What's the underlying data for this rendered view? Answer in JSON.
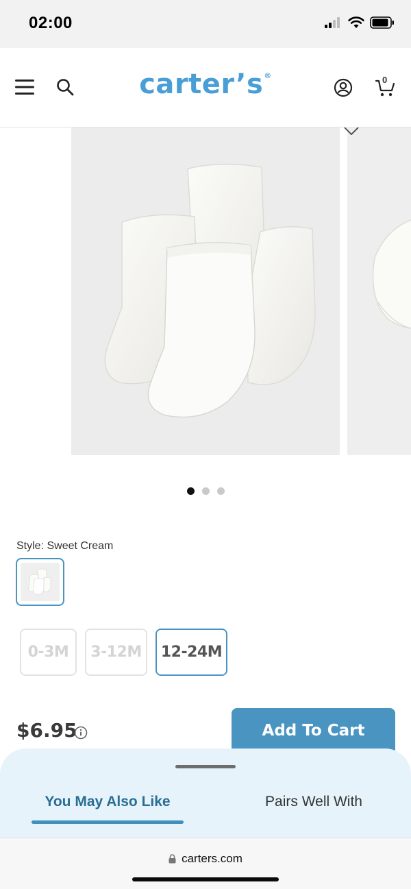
{
  "status_bar": {
    "time": "02:00"
  },
  "header": {
    "logo_text": "carter’s",
    "logo_mark": "®",
    "cart_count": "0",
    "icons": [
      "menu-icon",
      "search-icon",
      "account-icon",
      "cart-icon"
    ]
  },
  "gallery": {
    "total_slides": 3,
    "active_slide": 1,
    "image_description": "white baby socks"
  },
  "product": {
    "style_label": "Style: Sweet Cream",
    "sizes": [
      {
        "label": "0-3M",
        "state": "unavailable"
      },
      {
        "label": "3-12M",
        "state": "unavailable"
      },
      {
        "label": "12-24M",
        "state": "selected"
      }
    ],
    "price": "$6.95",
    "add_to_cart": "Add To Cart"
  },
  "bottom_sheet": {
    "tabs": [
      {
        "label": "You May Also Like",
        "active": true
      },
      {
        "label": "Pairs Well With",
        "active": false
      }
    ]
  },
  "browser": {
    "url": "carters.com"
  },
  "colors": {
    "brand_blue": "#4a9ed6",
    "button_blue": "#4a94c2",
    "sheet_bg": "#e6f3fa",
    "tab_active": "#2a6e94"
  }
}
